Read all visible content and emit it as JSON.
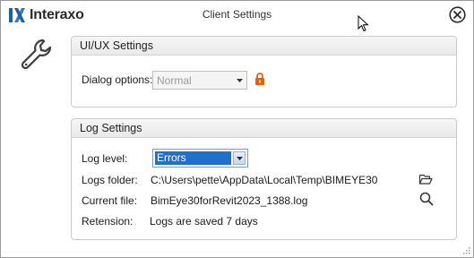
{
  "window": {
    "brand": "Interaxo",
    "title": "Client Settings"
  },
  "colors": {
    "brand_mark": "#1f5fa8",
    "lock": "#e8600c",
    "selection": "#1f6fce"
  },
  "ui_ux": {
    "header": "UI/UX Settings",
    "dialog_options_label": "Dialog options:",
    "dialog_options_value": "Normal"
  },
  "log": {
    "header": "Log Settings",
    "level_label": "Log level:",
    "level_value": "Errors",
    "folder_label": "Logs folder:",
    "folder_value": "C:\\Users\\pette\\AppData\\Local\\Temp\\BIMEYE30",
    "file_label": "Current file:",
    "file_value": "BimEye30forRevit2023_1388.log",
    "retention_label": "Retension:",
    "retention_value": "Logs are saved 7 days"
  },
  "icons": {
    "settings": "wrench-icon",
    "close": "close-icon",
    "lock": "lock-icon",
    "open_folder": "folder-open-icon",
    "search": "search-icon"
  }
}
